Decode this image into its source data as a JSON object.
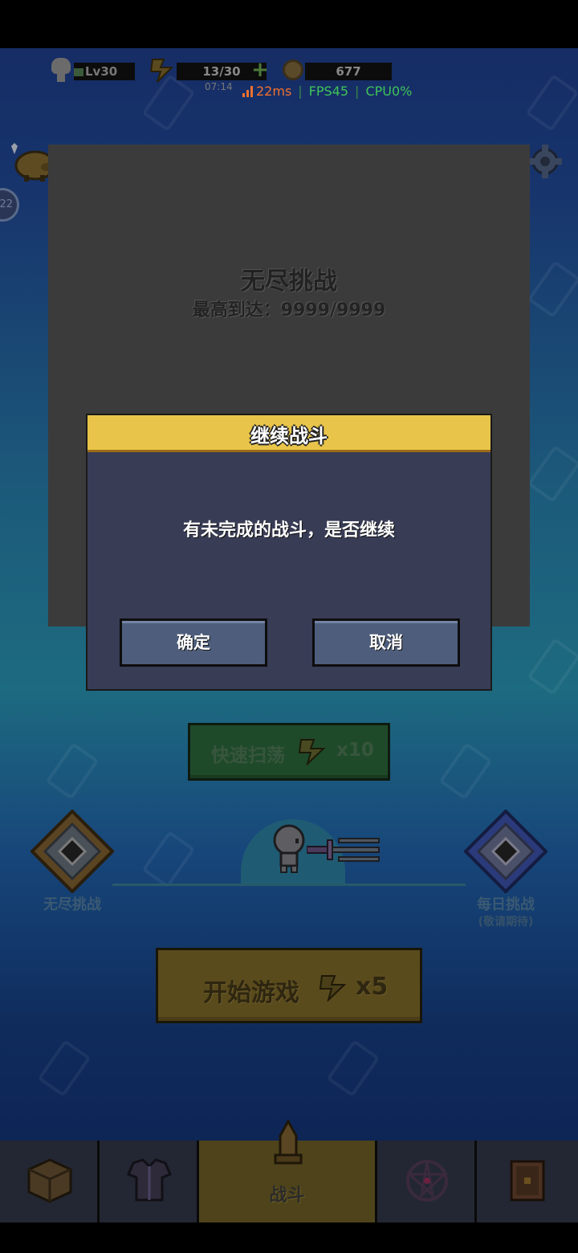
{
  "hud": {
    "level": "Lv30",
    "energy": "13/30",
    "energy_plus": "+",
    "timer": "07:14",
    "coins": "677"
  },
  "perf": {
    "ping": "22ms",
    "fps": "FPS45",
    "cpu": "CPU0%",
    "separator": "|"
  },
  "side": {
    "badge": "22"
  },
  "card": {
    "title": "无尽挑战",
    "best": "最高到达：9999/9999"
  },
  "dialog": {
    "title": "继续战斗",
    "message": "有未完成的战斗，是否继续",
    "confirm_label": "确定",
    "cancel_label": "取消"
  },
  "main": {
    "sweep_label": "快速扫荡",
    "sweep_cost": "x10",
    "left_mode_label": "无尽挑战",
    "right_mode_label": "每日挑战",
    "right_mode_sub": "(敬请期待)",
    "start_label": "开始游戏",
    "start_cost": "x5"
  },
  "nav": {
    "items": [
      {
        "icon": "box-icon",
        "label": ""
      },
      {
        "icon": "armor-icon",
        "label": ""
      },
      {
        "icon": "battle-icon",
        "label": "战斗"
      },
      {
        "icon": "pentagram-icon",
        "label": ""
      },
      {
        "icon": "book-icon",
        "label": ""
      }
    ],
    "active_index": 2
  },
  "colors": {
    "dialog_header": "#e8c54a",
    "dialog_body": "#383c55",
    "dialog_button": "#4d5d7b",
    "ping": "#f07030",
    "fps": "#3ec35a"
  }
}
